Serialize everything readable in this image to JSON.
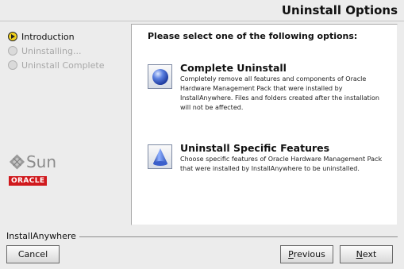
{
  "header": {
    "title": "Uninstall Options"
  },
  "steps": [
    {
      "label": "Introduction",
      "state": "current"
    },
    {
      "label": "Uninstalling...",
      "state": "disabled"
    },
    {
      "label": "Uninstall Complete",
      "state": "disabled"
    }
  ],
  "branding": {
    "sun": "Sun",
    "oracle": "ORACLE"
  },
  "panel": {
    "prompt": "Please select one of the following options:",
    "options": [
      {
        "title": "Complete Uninstall",
        "description": "Completely remove all features and components of Oracle Hardware Management Pack that were installed by InstallAnywhere. Files and folders created after the installation will not be affected.",
        "icon": "blue-sphere-icon"
      },
      {
        "title": "Uninstall Specific Features",
        "description": "Choose specific features of Oracle Hardware Management Pack that were installed by InstallAnywhere to be uninstalled.",
        "icon": "blue-cone-icon"
      }
    ]
  },
  "footer": {
    "brand": "InstallAnywhere",
    "cancel_label": "Cancel",
    "previous_first": "P",
    "previous_rest": "revious",
    "next_first": "N",
    "next_rest": "ext"
  },
  "colors": {
    "oracle_red": "#d0191d",
    "current_step": "#f2d21e"
  }
}
